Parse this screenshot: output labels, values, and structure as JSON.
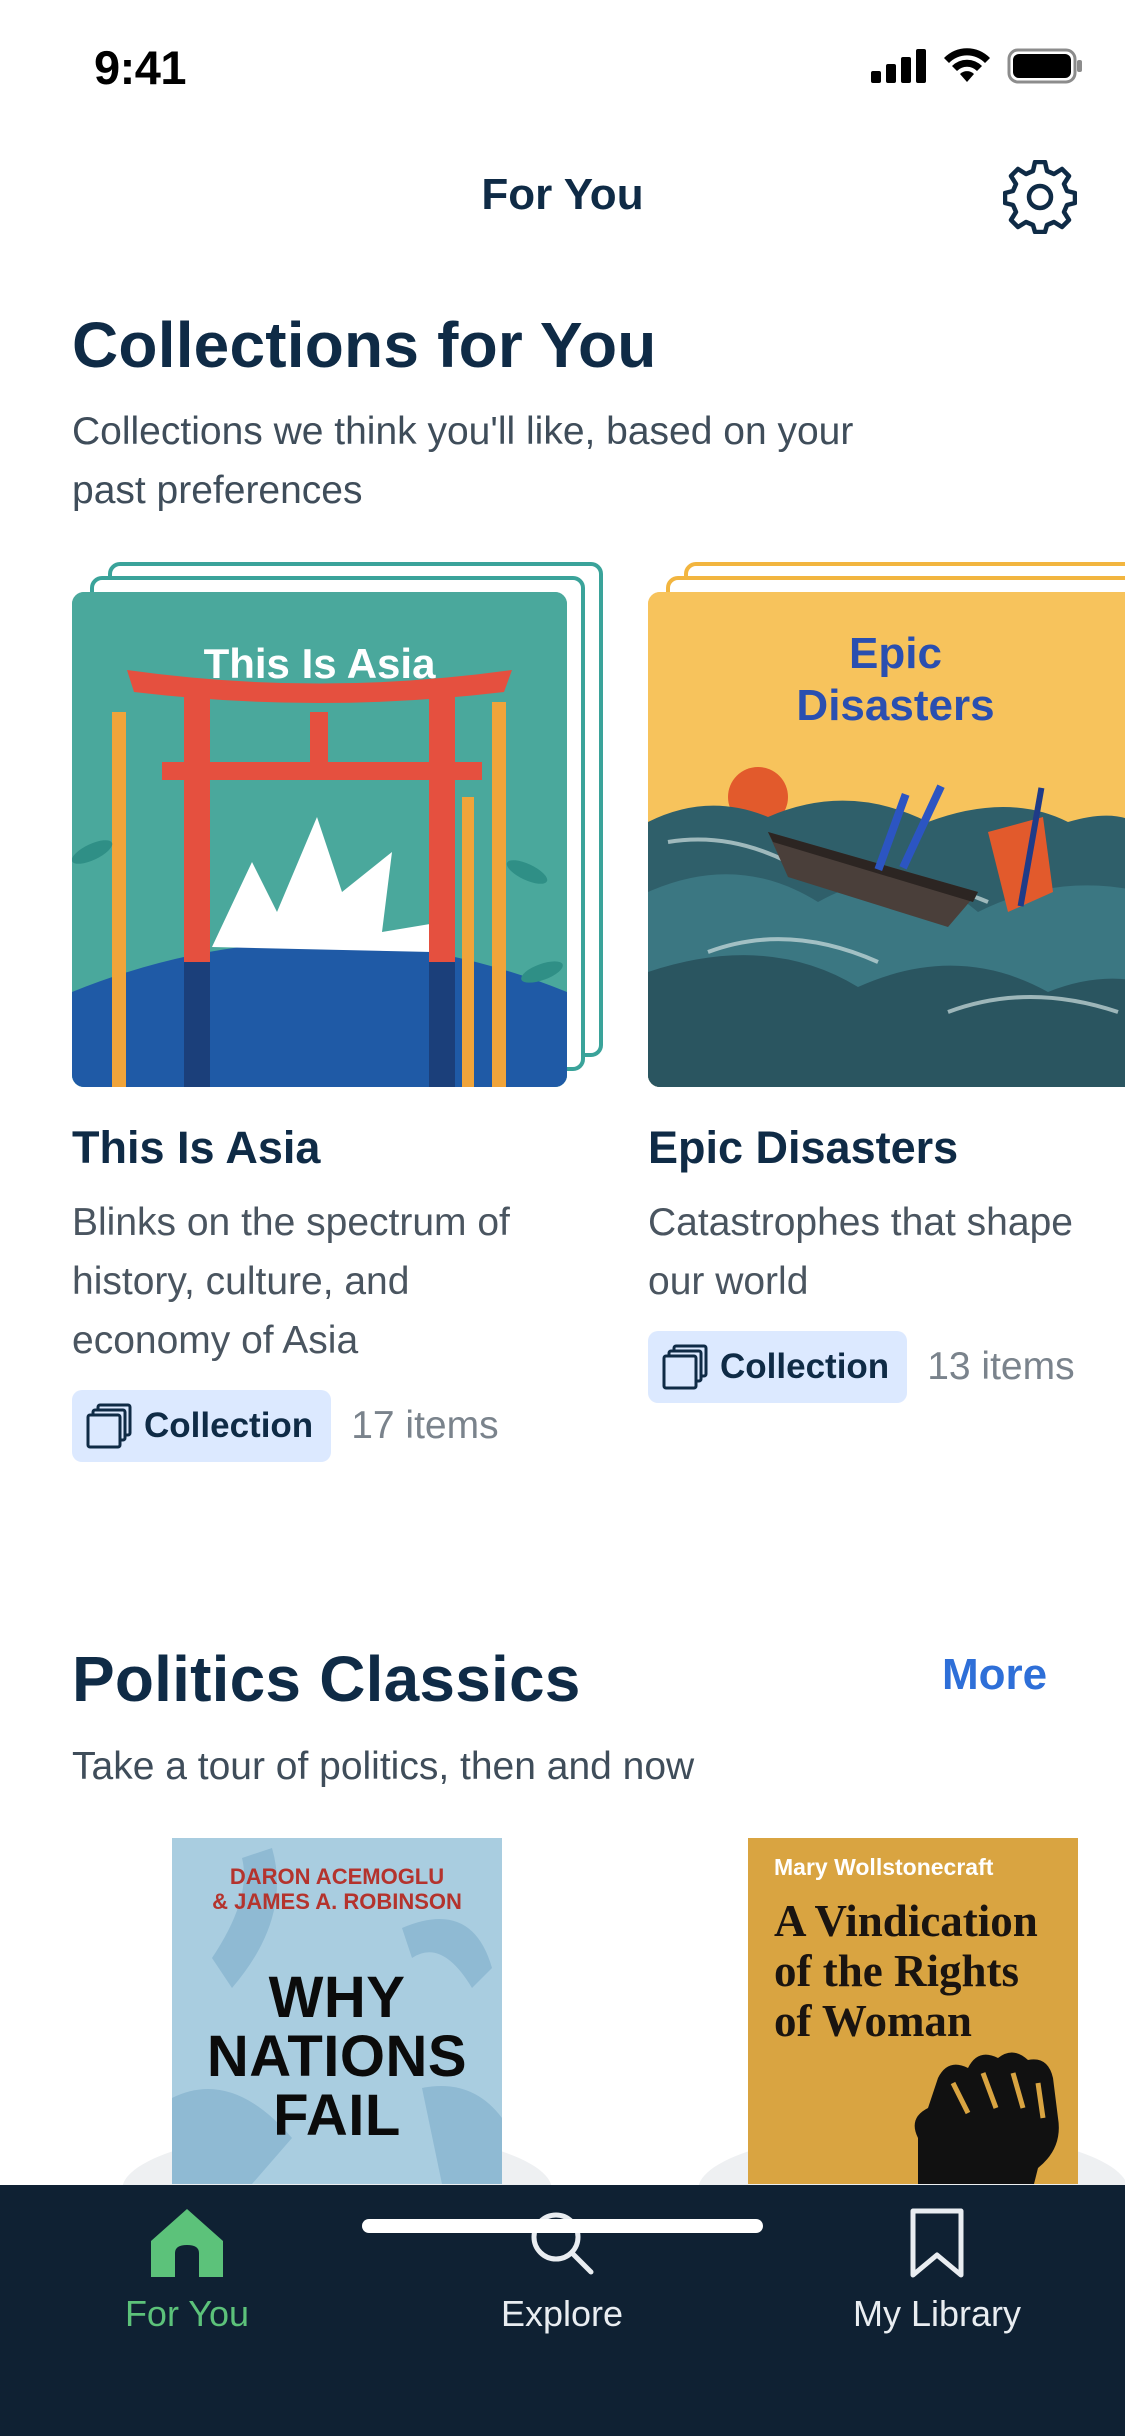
{
  "status": {
    "time": "9:41"
  },
  "header": {
    "title": "For You"
  },
  "collections_section": {
    "title": "Collections for You",
    "subtitle_lines": [
      "Collections we think you'll like, based on your",
      "past preferences"
    ],
    "cards": [
      {
        "cover_text": "This Is Asia",
        "title": "This Is Asia",
        "desc_lines": [
          "Blinks on the spectrum of",
          "history, culture, and",
          "economy of Asia"
        ],
        "chip_label": "Collection",
        "count": "17 items",
        "stack_color": "#3aa39a",
        "cover_bg": "#4aa89c"
      },
      {
        "cover_text_lines": [
          "Epic",
          "Disasters"
        ],
        "title": "Epic Disasters",
        "desc_lines": [
          "Catastrophes that shape",
          "our world"
        ],
        "chip_label": "Collection",
        "count": "13 items",
        "stack_color": "#f2b53f",
        "cover_bg": "#f7c35c"
      }
    ]
  },
  "politics_section": {
    "title": "Politics Classics",
    "more_label": "More",
    "subtitle": "Take a tour of politics, then and now",
    "books": [
      {
        "author_lines": [
          "DARON ACEMOGLU",
          "& JAMES A. ROBINSON"
        ],
        "title_lines": [
          "WHY",
          "NATIONS",
          "FAIL"
        ],
        "bg": "#a9cde0"
      },
      {
        "author": "Mary Wollstonecraft",
        "title_lines": [
          "A Vindication",
          "of the Rights",
          "of Woman"
        ],
        "bg": "#d9a441"
      }
    ]
  },
  "tab_bar": {
    "tabs": [
      {
        "label": "For You",
        "icon": "home-icon",
        "active": true
      },
      {
        "label": "Explore",
        "icon": "search-icon",
        "active": false
      },
      {
        "label": "My Library",
        "icon": "bookmark-icon",
        "active": false
      }
    ],
    "active_color": "#5cc27a"
  },
  "colors": {
    "accent": "#2e6fd8",
    "navy": "#0f2b46",
    "chip": "#dce9ff"
  }
}
